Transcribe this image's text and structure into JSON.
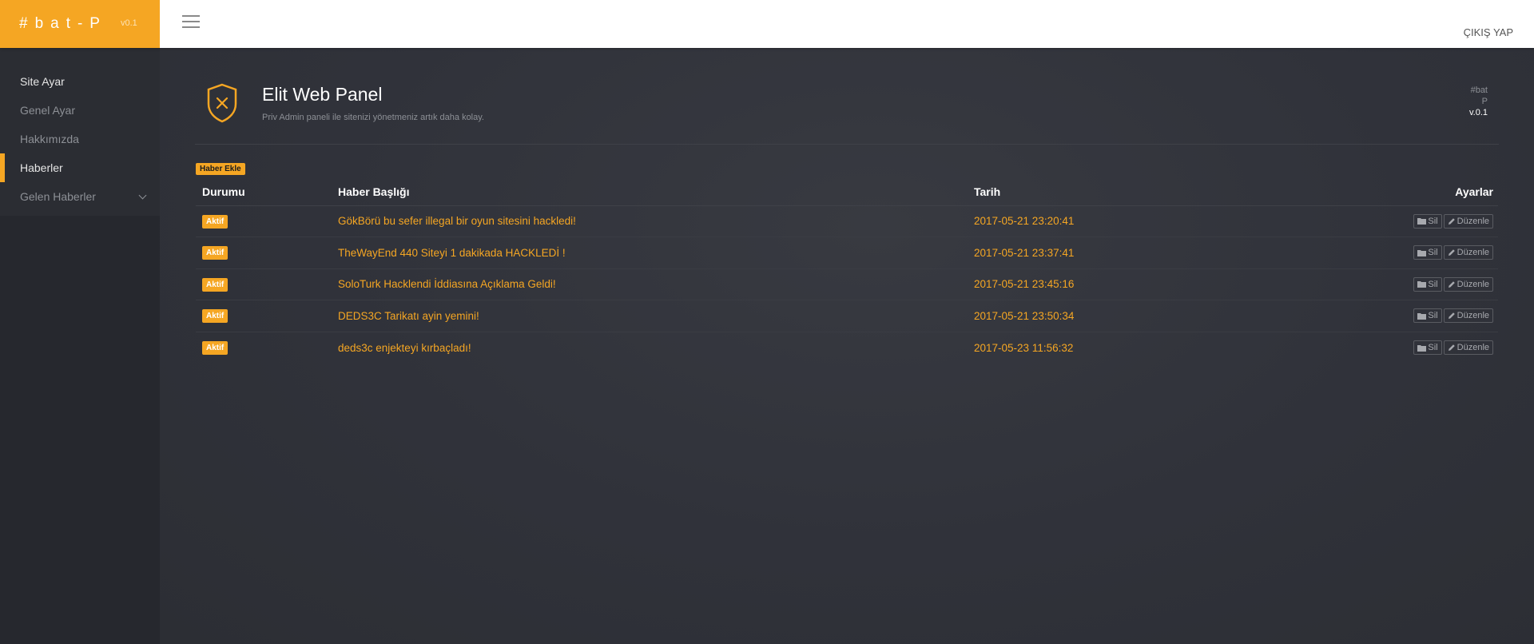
{
  "brand": {
    "name": "#bat-P",
    "version": "v0.1"
  },
  "topbar": {
    "logout_label": "ÇIKIŞ YAP"
  },
  "sidebar": {
    "items": [
      {
        "label": "Site Ayar"
      },
      {
        "label": "Genel Ayar"
      },
      {
        "label": "Hakkımızda"
      },
      {
        "label": "Haberler"
      },
      {
        "label": "Gelen Haberler"
      }
    ]
  },
  "header": {
    "title": "Elit Web Panel",
    "subtitle": "Priv Admin paneli ile sitenizi yönetmeniz artık daha kolay.",
    "right_line1": "#bat",
    "right_line2": "P",
    "right_version": "v.0.1"
  },
  "add_button_label": "Haber Ekle",
  "table": {
    "headers": {
      "status": "Durumu",
      "title": "Haber Başlığı",
      "date": "Tarih",
      "settings": "Ayarlar"
    },
    "delete_label": "Sil",
    "edit_label": "Düzenle",
    "rows": [
      {
        "status": "Aktif",
        "title": "GökBörü bu sefer illegal bir oyun sitesini hackledi!",
        "date": "2017-05-21 23:20:41"
      },
      {
        "status": "Aktif",
        "title": "TheWayEnd 440 Siteyi 1 dakikada HACKLEDİ !",
        "date": "2017-05-21 23:37:41"
      },
      {
        "status": "Aktif",
        "title": "SoloTurk Hacklendi İddiasına Açıklama Geldi!",
        "date": "2017-05-21 23:45:16"
      },
      {
        "status": "Aktif",
        "title": "DEDS3C Tarikatı ayin yemini!",
        "date": "2017-05-21 23:50:34"
      },
      {
        "status": "Aktif",
        "title": "deds3c enjekteyi kırbaçladı!",
        "date": "2017-05-23 11:56:32"
      }
    ]
  },
  "icons": {
    "menu": "hamburger-icon",
    "shield": "shield-x-icon",
    "delete": "folder-icon",
    "edit": "pencil-icon",
    "submenu": "chevron-down-icon"
  },
  "colors": {
    "accent": "#f5a623",
    "sidebar_bg": "#26282e",
    "main_bg": "#2f3138",
    "topbar_bg": "#ffffff"
  }
}
